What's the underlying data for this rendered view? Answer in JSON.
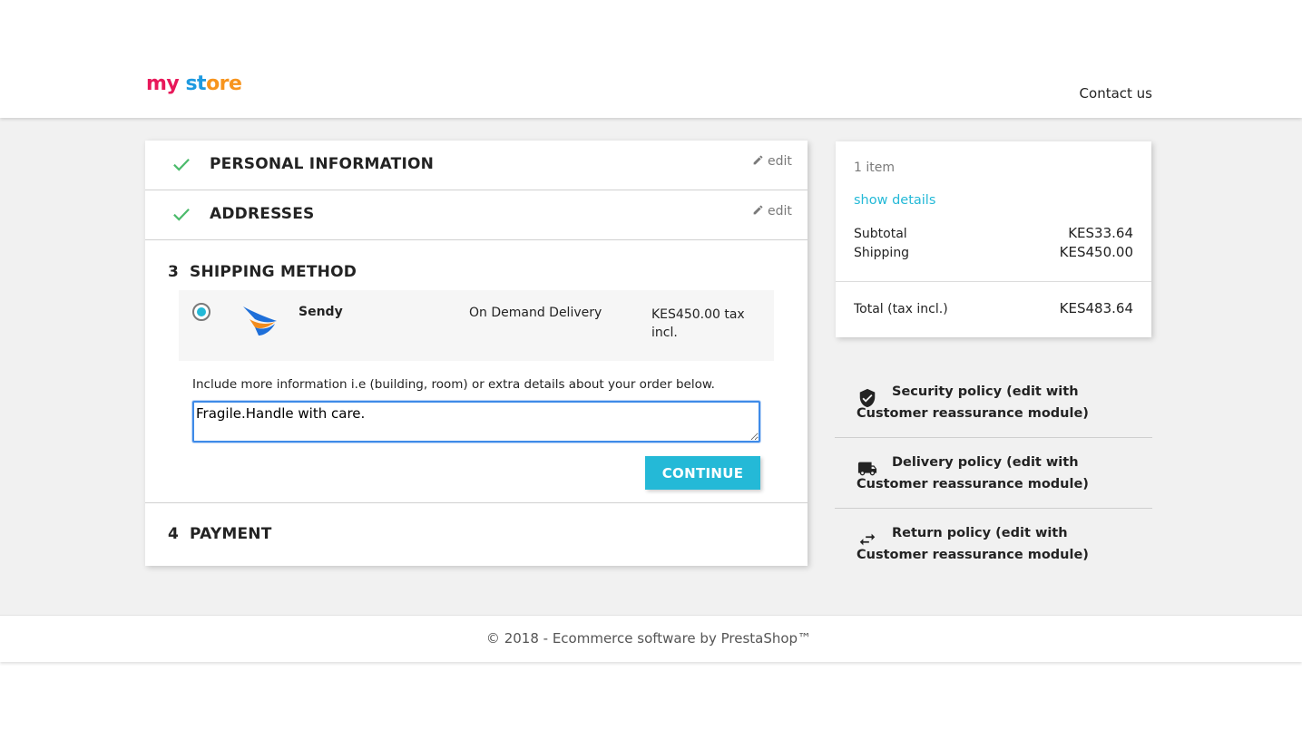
{
  "header": {
    "logo": [
      "my",
      " ",
      "st",
      "ore"
    ],
    "contact": "Contact us"
  },
  "checkout": {
    "steps": [
      {
        "title": "PERSONAL INFORMATION",
        "status": "complete",
        "edit_label": "edit"
      },
      {
        "title": "ADDRESSES",
        "status": "complete",
        "edit_label": "edit"
      },
      {
        "number": "3",
        "title": "SHIPPING METHOD",
        "status": "current"
      },
      {
        "number": "4",
        "title": "PAYMENT",
        "status": "pending"
      }
    ],
    "shipping": {
      "carrier_name": "Sendy",
      "carrier_delay": "On Demand Delivery",
      "carrier_price": "KES450.00 tax incl.",
      "selected": true,
      "note_label": "Include more information i.e (building, room) or extra details about your order below.",
      "note_value": "Fragile.Handle with care.",
      "continue_label": "CONTINUE"
    }
  },
  "cart_summary": {
    "items_count": "1 item",
    "show_details": "show details",
    "subtotal_label": "Subtotal",
    "subtotal_value": "KES33.64",
    "shipping_label": "Shipping",
    "shipping_value": "KES450.00",
    "total_label": "Total (tax incl.)",
    "total_value": "KES483.64"
  },
  "reassurance": [
    {
      "icon": "shield-icon",
      "text": "Security policy (edit with Customer reassurance module)"
    },
    {
      "icon": "truck-icon",
      "text": "Delivery policy (edit with Customer reassurance module)"
    },
    {
      "icon": "swap-arrows-icon",
      "text": "Return policy (edit with Customer reassurance module)"
    }
  ],
  "footer": {
    "text": "© 2018 - Ecommerce software by PrestaShop™"
  },
  "colors": {
    "accent": "#24b9d7",
    "check": "#4cbb6c",
    "page_bg": "#f1f1f1"
  }
}
